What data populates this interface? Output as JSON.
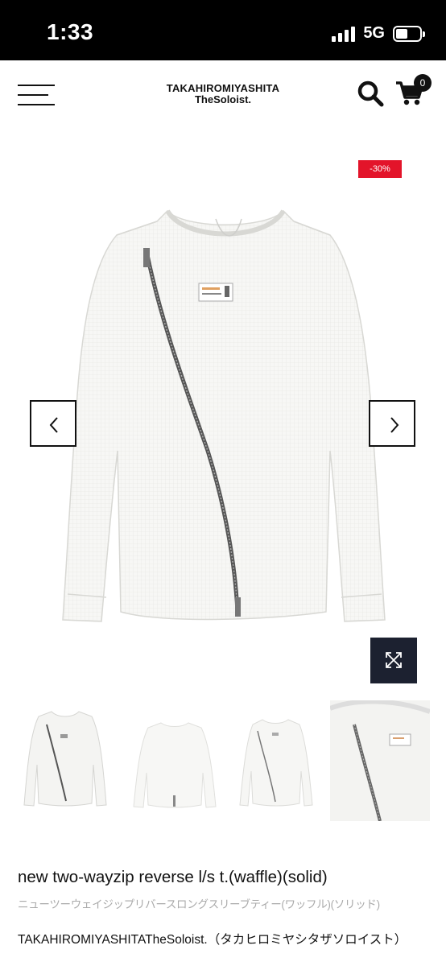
{
  "status_bar": {
    "time": "1:33",
    "network": "5G"
  },
  "header": {
    "logo_line1": "TAKAHIROMIYASHITA",
    "logo_line2": "TheSoloist.",
    "cart_count": "0",
    "icons": [
      "hamburger-menu-icon",
      "search-icon",
      "cart-icon"
    ]
  },
  "gallery": {
    "sale_badge": "-30%",
    "prev_icon": "chevron-left-icon",
    "next_icon": "chevron-right-icon",
    "zoom_icon": "expand-icon",
    "thumbnail_count": 4
  },
  "product": {
    "title": "new two-wayzip reverse l/s t.(waffle)(solid)",
    "subtitle": "ニューツーウェイジップリバースロングスリーブティー(ワッフル)(ソリッド)",
    "brand": "TAKAHIROMIYASHITATheSoloist.（タカヒロミヤシタザソロイスト）"
  },
  "colors": {
    "sale_red": "#e3142a",
    "zoom_navy": "#1c2130"
  }
}
